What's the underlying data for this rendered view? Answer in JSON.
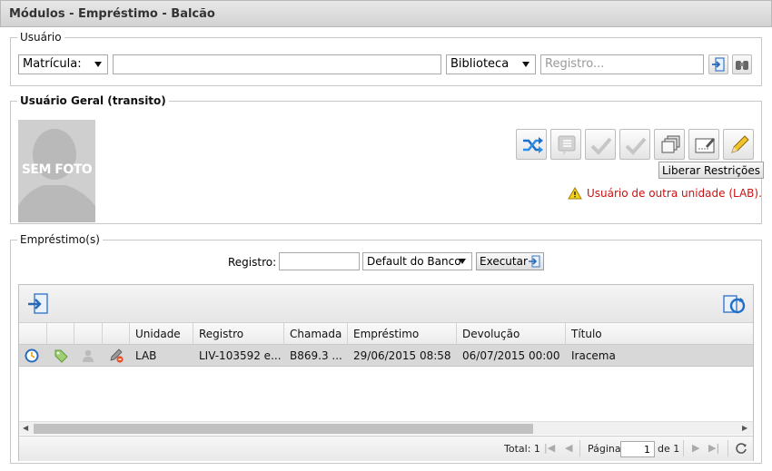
{
  "window": {
    "title": "Módulos - Empréstimo - Balcão"
  },
  "usuario": {
    "legend": "Usuário",
    "id_type_select": "Matrícula:",
    "id_value": "",
    "scope_select": "Biblioteca",
    "registro_placeholder": "Registro...",
    "icons": [
      "enter-icon",
      "binoculars-icon"
    ]
  },
  "usuario_geral": {
    "legend": "Usuário Geral (transito)",
    "photo_label": "SEM FOTO",
    "action_icons": [
      "shuffle-icon",
      "message-icon",
      "check-disabled-icon",
      "check-disabled-icon",
      "windows-icon",
      "form-edit-icon",
      "pencil-icon"
    ],
    "liberar_button": "Liberar Restrições",
    "warning_text": "Usuário de outra unidade (LAB)."
  },
  "emprestimos": {
    "legend": "Empréstimo(s)",
    "registro_label": "Registro:",
    "registro_value": "",
    "bank_select": "Default do Banco",
    "execute_button": "Executar",
    "columns": [
      "",
      "",
      "",
      "",
      "Unidade",
      "Registro",
      "Chamada",
      "Empréstimo",
      "Devolução",
      "Título"
    ],
    "rows": [
      {
        "icons": [
          "clock-icon",
          "tag-icon",
          "person-icon",
          "pencil-cancel-icon"
        ],
        "unidade": "LAB",
        "registro": "LIV-103592 e...",
        "chamada": "B869.3 ...",
        "emprestimo": "29/06/2015 08:58",
        "devolucao": "06/07/2015 00:00",
        "titulo": "Iracema"
      }
    ],
    "pager": {
      "total_label": "Total: 1",
      "page_label": "Página",
      "page_value": "1",
      "of_label": "de 1"
    }
  }
}
